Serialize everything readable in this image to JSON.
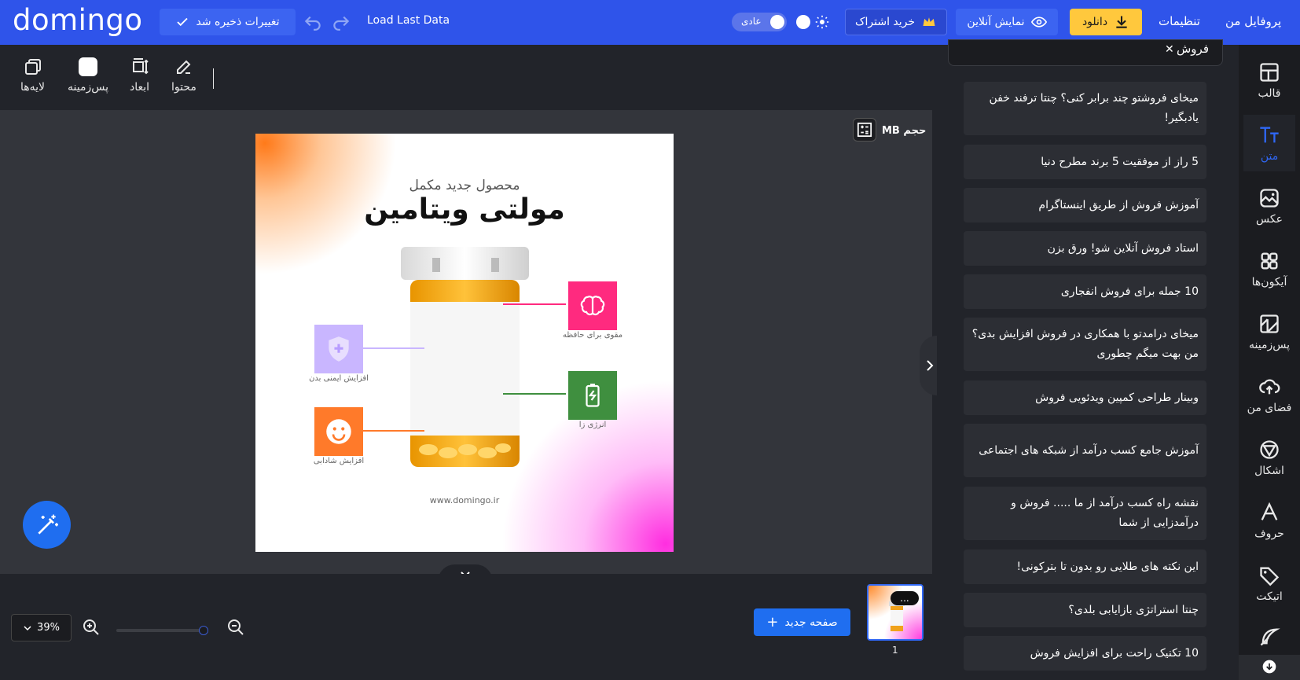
{
  "header": {
    "logo": "domingo",
    "saved_label": "تغییرات ذخیره شد",
    "load_last_label": "Load Last Data",
    "mode_label": "عادی",
    "subscribe_label": "خرید اشتراک",
    "online_view_label": "نمایش آنلاین",
    "download_label": "دانلود",
    "settings_label": "تنظیمات",
    "profile_label": "پروفایل من"
  },
  "toolbar": {
    "content_label": "محتوا",
    "dimensions_label": "ابعاد",
    "background_label": "پس‌زمینه",
    "layers_label": "لایه‌ها"
  },
  "canvas": {
    "size_label": "حجم MB",
    "design": {
      "subtitle": "محصول جدید مکمل",
      "title": "مولتی ویتامین",
      "features": [
        {
          "label": "مقوی برای حافظه",
          "color": "#ff2a7f"
        },
        {
          "label": "افزایش ایمنی بدن",
          "color": "#b79cff"
        },
        {
          "label": "انرژی زا",
          "color": "#3f8f3f"
        },
        {
          "label": "افزایش شادابی",
          "color": "#ff7a2a"
        }
      ],
      "url": "www.domingo.ir"
    }
  },
  "bottom": {
    "zoom_value": "39%",
    "new_page_label": "صفحه جدید",
    "page_number": "1",
    "thumb_more": "..."
  },
  "panel": {
    "search_value": "فروش",
    "items": [
      "میخای فروشتو چند برابر کنی؟ چنتا ترفند خفن یادبگیر!",
      "5 راز از موفقیت 5 برند مطرح دنیا",
      "آموزش فروش از طریق اینستاگرام",
      "استاد فروش آنلاین شو! ورق بزن",
      "10 جمله برای فروش انفجاری",
      "میخای درامدتو با همکاری در فروش افزایش بدی؟ من بهت میگم چطوری",
      "وبینار طراحی کمپین ویدئویی فروش",
      "آموزش جامع کسب درآمد از شبکه های اجتماعی",
      "نقشه راه کسب درآمد از ما ..... فروش و درآمدزایی از شما",
      "این نکته های طلایی رو بدون تا بترکونی!",
      "چنتا استراتژی بازایابی بلدی؟",
      "10 تکنیک راحت برای افزایش فروش"
    ]
  },
  "rail": {
    "items": [
      {
        "label": "قالب",
        "icon": "template-icon"
      },
      {
        "label": "متن",
        "icon": "text-icon"
      },
      {
        "label": "عکس",
        "icon": "image-icon"
      },
      {
        "label": "آیکون‌ها",
        "icon": "grid-icon"
      },
      {
        "label": "پس‌زمینه",
        "icon": "background-icon"
      },
      {
        "label": "فضای من",
        "icon": "upload-cloud-icon"
      },
      {
        "label": "اشکال",
        "icon": "shapes-icon"
      },
      {
        "label": "حروف",
        "icon": "font-icon"
      },
      {
        "label": "اتیکت",
        "icon": "tag-icon"
      }
    ]
  },
  "colors": {
    "topbar": "#2f54ea",
    "accent": "#1f6ef0",
    "download": "#ffc83d",
    "panel_bg": "#22242a",
    "card_bg": "#2c2e34"
  }
}
